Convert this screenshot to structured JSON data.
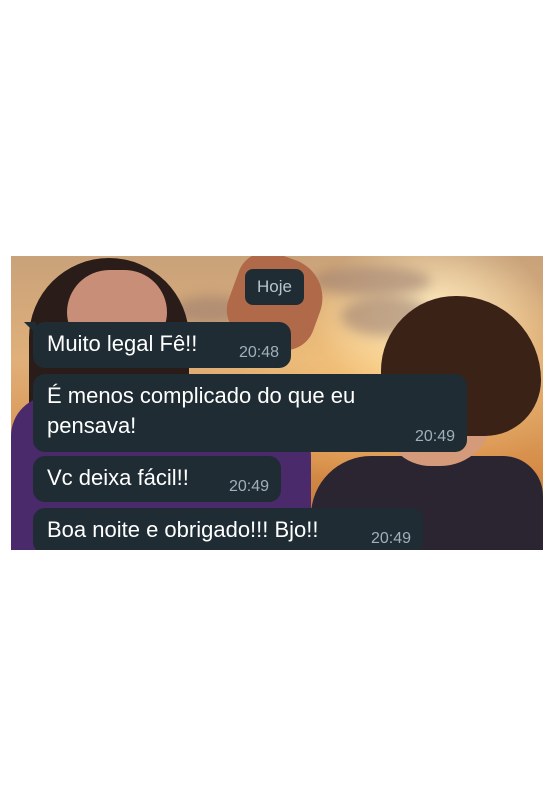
{
  "chat": {
    "date_separator": "Hoje",
    "messages": [
      {
        "text": "Muito legal Fê!!",
        "time": "20:48"
      },
      {
        "text": "É menos complicado do que eu pensava!",
        "time": "20:49"
      },
      {
        "text": "Vc deixa fácil!!",
        "time": "20:49"
      },
      {
        "text": "Boa noite e obrigado!!! Bjo!!",
        "time": "20:49"
      }
    ]
  },
  "colors": {
    "bubble_background": "#1f2c34",
    "timestamp": "#9fb0ba",
    "page_background": "#ffffff"
  }
}
